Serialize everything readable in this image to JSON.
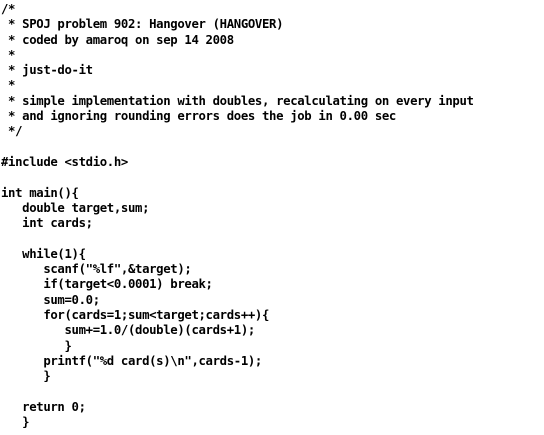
{
  "code": {
    "lines": [
      "/*",
      " * SPOJ problem 902: Hangover (HANGOVER)",
      " * coded by amaroq on sep 14 2008",
      " *",
      " * just-do-it",
      " *",
      " * simple implementation with doubles, recalculating on every input",
      " * and ignoring rounding errors does the job in 0.00 sec",
      " */",
      "",
      "#include <stdio.h>",
      "",
      "int main(){",
      "   double target,sum;",
      "   int cards;",
      "",
      "   while(1){",
      "      scanf(\"%lf\",&target);",
      "      if(target<0.0001) break;",
      "      sum=0.0;",
      "      for(cards=1;sum<target;cards++){",
      "         sum+=1.0/(double)(cards+1);",
      "         }",
      "      printf(\"%d card(s)\\n\",cards-1);",
      "      }",
      "",
      "   return 0;",
      "   }"
    ]
  }
}
